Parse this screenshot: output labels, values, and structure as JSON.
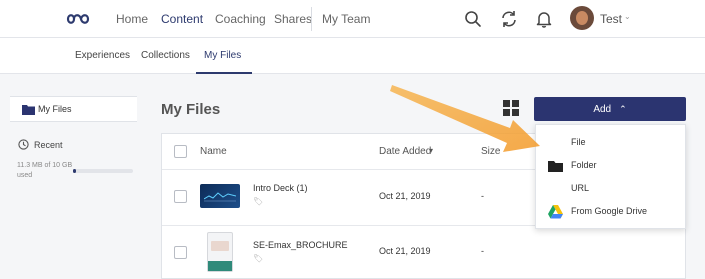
{
  "topnav": {
    "logo_icon": "infinity-logo-icon",
    "links": [
      "Home",
      "Content",
      "Coaching",
      "Shares",
      "My Team"
    ],
    "active_link": "Content",
    "icons": [
      "search-icon",
      "sync-icon",
      "bell-icon"
    ],
    "user_name": "Test",
    "user_chevron": "⌄"
  },
  "subnav": {
    "tabs": [
      "Experiences",
      "Collections",
      "My Files"
    ],
    "active_tab": "My Files"
  },
  "sidebar": {
    "my_files_label": "My Files",
    "recent_label": "Recent",
    "storage_text": "11.3 MB of 10 GB used",
    "storage_fraction": 0.02
  },
  "main": {
    "title": "My Files",
    "add_button_label": "Add",
    "add_button_chevron": "⌃",
    "columns": [
      "Name",
      "Date Added",
      "Size"
    ],
    "sort_indicator": "▾",
    "rows": [
      {
        "name": "Intro Deck (1)",
        "date": "Oct 21, 2019",
        "size": "-"
      },
      {
        "name": "SE-Emax_BROCHURE",
        "date": "Oct 21, 2019",
        "size": "-"
      }
    ]
  },
  "dropdown": {
    "items": [
      {
        "label": "File",
        "icon": ""
      },
      {
        "label": "Folder",
        "icon": "folder-icon"
      },
      {
        "label": "URL",
        "icon": ""
      },
      {
        "label": "From Google Drive",
        "icon": "google-drive-icon"
      }
    ]
  },
  "colors": {
    "brand_navy": "#2b3470",
    "annotation_arrow": "#f4a83a"
  }
}
